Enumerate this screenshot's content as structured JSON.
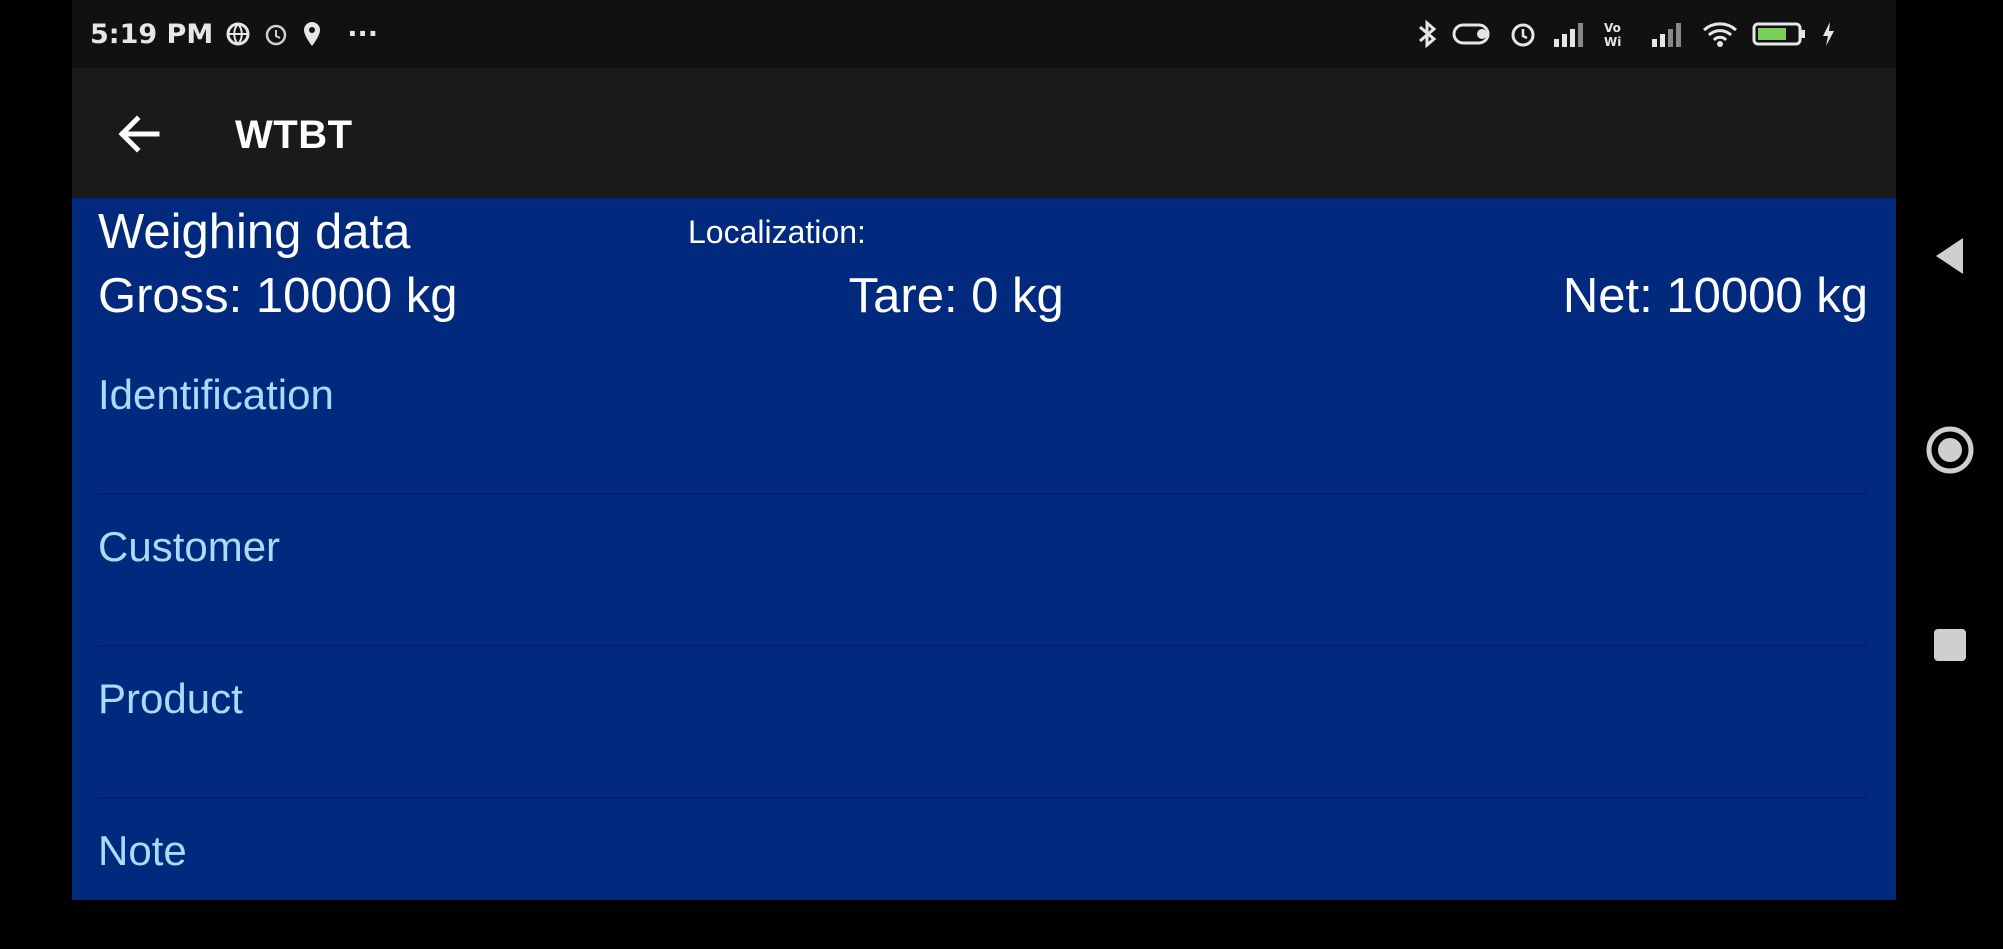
{
  "status_bar": {
    "time": "5:19 PM",
    "more": "···",
    "icons": [
      "browser-icon",
      "alarm-icon",
      "location-icon",
      "bluetooth-icon",
      "key-icon",
      "alarm-icon",
      "signal-icon",
      "volte-icon",
      "signal-icon",
      "wifi-icon",
      "battery-icon",
      "charging-icon"
    ]
  },
  "app_bar": {
    "title": "WTBT",
    "back_icon": "arrow-left-icon"
  },
  "weighing": {
    "title": "Weighing data",
    "localization_label": "Localization:",
    "gross": "Gross: 10000 kg",
    "tare": "Tare: 0 kg",
    "net": "Net: 10000 kg"
  },
  "list": {
    "items": [
      {
        "label": "Identification"
      },
      {
        "label": "Customer"
      },
      {
        "label": "Product"
      },
      {
        "label": "Note"
      }
    ]
  },
  "colors": {
    "content_bg": "#012a7e",
    "label_color": "#a8dcfa",
    "app_bar_bg": "#1a1a1a"
  },
  "nav_bar": {
    "icons": [
      "back-triangle-icon",
      "home-circle-icon",
      "recents-square-icon"
    ]
  }
}
